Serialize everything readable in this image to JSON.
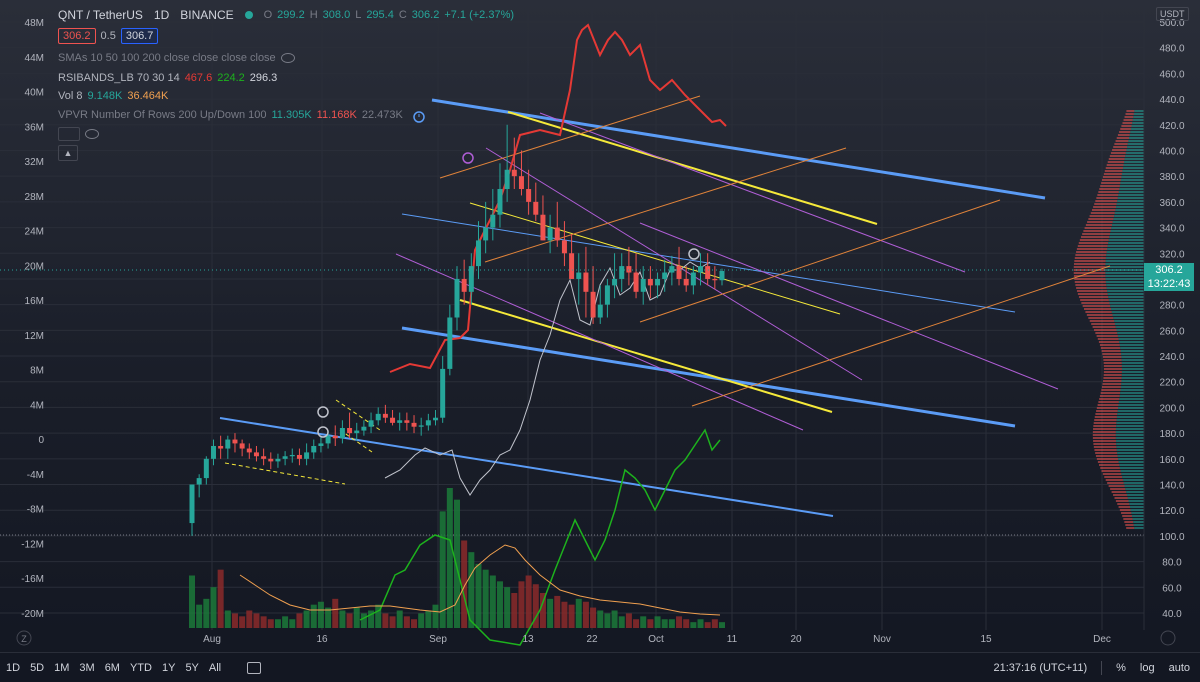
{
  "header": {
    "symbol": "QNT / TetherUS",
    "interval": "1D",
    "exchange": "BINANCE",
    "ohlc": {
      "o_label": "O",
      "o": "299.2",
      "h_label": "H",
      "h": "308.0",
      "l_label": "L",
      "l": "295.4",
      "c_label": "C",
      "c": "306.2",
      "change": "+7.1 (+2.37%)"
    },
    "bid": "306.2",
    "spread": "0.5",
    "ask": "306.7"
  },
  "indicators": [
    {
      "name": "SMAs 10 50 100 200 close close close close",
      "values": []
    },
    {
      "name": "RSIBANDS_LB 70 30 14",
      "values": [
        "467.6",
        "224.2",
        "296.3"
      ]
    },
    {
      "name": "Vol 8",
      "values": [
        "9.148K",
        "36.464K"
      ]
    },
    {
      "name": "VPVR Number Of Rows 200 Up/Down 100",
      "values": [
        "11.305K",
        "11.168K",
        "22.473K"
      ]
    }
  ],
  "price_axis": {
    "currency_button": "USDT",
    "labels": [
      "500.0",
      "480.0",
      "460.0",
      "440.0",
      "420.0",
      "400.0",
      "380.0",
      "360.0",
      "340.0",
      "320.0",
      "300.0",
      "280.0",
      "260.0",
      "240.0",
      "220.0",
      "200.0",
      "180.0",
      "160.0",
      "140.0",
      "120.0",
      "100.0",
      "80.0",
      "60.0",
      "40.0"
    ],
    "last_price": "306.2",
    "countdown": "13:22:43"
  },
  "left_axis": {
    "labels": [
      "48M",
      "44M",
      "40M",
      "36M",
      "32M",
      "28M",
      "24M",
      "20M",
      "16M",
      "12M",
      "8M",
      "4M",
      "0",
      "-4M",
      "-8M",
      "-12M",
      "-16M",
      "-20M"
    ]
  },
  "time_axis": {
    "labels": [
      "Aug",
      "16",
      "Sep",
      "13",
      "22",
      "Oct",
      "11",
      "20",
      "Nov",
      "15",
      "Dec"
    ]
  },
  "bottom_bar": {
    "timeframes": [
      "1D",
      "5D",
      "1M",
      "3M",
      "6M",
      "YTD",
      "1Y",
      "5Y",
      "All"
    ],
    "clock": "21:37:16 (UTC+11)",
    "percent_label": "%",
    "log_label": "log",
    "auto_label": "auto"
  },
  "colors": {
    "background": "#131722",
    "up": "#26a69a",
    "down": "#ef5350",
    "blue_channel": "#5b9cf6",
    "yellow_channel": "#f5e93a",
    "purple_channel": "#b05ed6",
    "orange_channel": "#e0833a",
    "rsi_red": "#e53935",
    "rsi_green": "#1db21d"
  },
  "chart_data": {
    "type": "candlestick",
    "x_dates": [
      "Jul 28",
      "Jul 29",
      "Jul 30",
      "Jul 31",
      "Aug 1",
      "Aug 2",
      "Aug 3",
      "Aug 4",
      "Aug 5",
      "Aug 6",
      "Aug 7",
      "Aug 8",
      "Aug 9",
      "Aug 10",
      "Aug 11",
      "Aug 12",
      "Aug 13",
      "Aug 14",
      "Aug 15",
      "Aug 16",
      "Aug 17",
      "Aug 18",
      "Aug 19",
      "Aug 20",
      "Aug 21",
      "Aug 22",
      "Aug 23",
      "Aug 24",
      "Aug 25",
      "Aug 26",
      "Aug 27",
      "Aug 28",
      "Aug 29",
      "Aug 30",
      "Aug 31",
      "Sep 1",
      "Sep 2",
      "Sep 3",
      "Sep 4",
      "Sep 5",
      "Sep 6",
      "Sep 7",
      "Sep 8",
      "Sep 9",
      "Sep 10",
      "Sep 11",
      "Sep 12",
      "Sep 13",
      "Sep 14",
      "Sep 15",
      "Sep 16",
      "Sep 17",
      "Sep 18",
      "Sep 19",
      "Sep 20",
      "Sep 21",
      "Sep 22",
      "Sep 23",
      "Sep 24",
      "Sep 25",
      "Sep 26",
      "Sep 27",
      "Sep 28",
      "Sep 29",
      "Sep 30",
      "Oct 1",
      "Oct 2",
      "Oct 3",
      "Oct 4",
      "Oct 5",
      "Oct 6",
      "Oct 7",
      "Oct 8",
      "Oct 9",
      "Oct 10"
    ],
    "open": [
      110,
      140,
      145,
      160,
      170,
      168,
      175,
      172,
      168,
      165,
      162,
      160,
      158,
      160,
      162,
      163,
      160,
      165,
      170,
      172,
      178,
      176,
      184,
      180,
      182,
      185,
      190,
      195,
      192,
      188,
      190,
      188,
      185,
      186,
      190,
      192,
      230,
      270,
      300,
      290,
      310,
      330,
      340,
      350,
      370,
      385,
      380,
      370,
      360,
      350,
      330,
      340,
      330,
      320,
      300,
      305,
      290,
      270,
      280,
      295,
      300,
      310,
      305,
      290,
      300,
      295,
      300,
      305,
      310,
      300,
      295,
      305,
      310,
      300,
      299
    ],
    "high": [
      140,
      148,
      162,
      175,
      178,
      178,
      180,
      175,
      172,
      170,
      168,
      165,
      164,
      166,
      168,
      168,
      172,
      175,
      178,
      182,
      186,
      190,
      196,
      188,
      190,
      196,
      200,
      202,
      198,
      196,
      196,
      194,
      192,
      195,
      198,
      240,
      280,
      310,
      315,
      320,
      345,
      360,
      370,
      390,
      420,
      410,
      400,
      385,
      375,
      365,
      350,
      360,
      345,
      335,
      320,
      325,
      310,
      295,
      300,
      320,
      320,
      325,
      320,
      310,
      310,
      305,
      315,
      318,
      325,
      310,
      310,
      320,
      320,
      310,
      308
    ],
    "low": [
      100,
      130,
      140,
      155,
      160,
      160,
      165,
      162,
      160,
      158,
      155,
      152,
      153,
      155,
      157,
      155,
      155,
      160,
      165,
      168,
      170,
      172,
      176,
      174,
      178,
      180,
      186,
      188,
      186,
      182,
      182,
      180,
      178,
      182,
      186,
      188,
      225,
      260,
      280,
      280,
      300,
      320,
      330,
      340,
      360,
      370,
      365,
      350,
      345,
      330,
      320,
      325,
      310,
      300,
      280,
      270,
      265,
      265,
      270,
      285,
      290,
      295,
      285,
      280,
      285,
      285,
      290,
      295,
      295,
      290,
      288,
      295,
      295,
      292,
      295
    ],
    "close": [
      140,
      145,
      160,
      170,
      168,
      175,
      172,
      168,
      165,
      162,
      160,
      158,
      160,
      162,
      163,
      160,
      165,
      170,
      172,
      178,
      176,
      184,
      180,
      182,
      185,
      190,
      195,
      192,
      188,
      190,
      188,
      185,
      186,
      190,
      192,
      230,
      270,
      300,
      290,
      310,
      330,
      340,
      350,
      370,
      385,
      380,
      370,
      360,
      350,
      330,
      340,
      330,
      320,
      300,
      305,
      290,
      270,
      280,
      295,
      300,
      310,
      305,
      290,
      300,
      295,
      300,
      305,
      310,
      300,
      295,
      305,
      310,
      300,
      299,
      306.2
    ],
    "volume": [
      18,
      8,
      10,
      14,
      20,
      6,
      5,
      4,
      6,
      5,
      4,
      3,
      3,
      4,
      3,
      5,
      6,
      8,
      9,
      7,
      10,
      6,
      5,
      7,
      5,
      6,
      8,
      5,
      4,
      6,
      4,
      3,
      5,
      6,
      8,
      40,
      48,
      44,
      30,
      26,
      22,
      20,
      18,
      16,
      14,
      12,
      16,
      18,
      15,
      12,
      10,
      11,
      9,
      8,
      10,
      9,
      7,
      6,
      5,
      6,
      4,
      5,
      3,
      4,
      3,
      4,
      3,
      3,
      4,
      3,
      2,
      3,
      2,
      3,
      2
    ]
  }
}
